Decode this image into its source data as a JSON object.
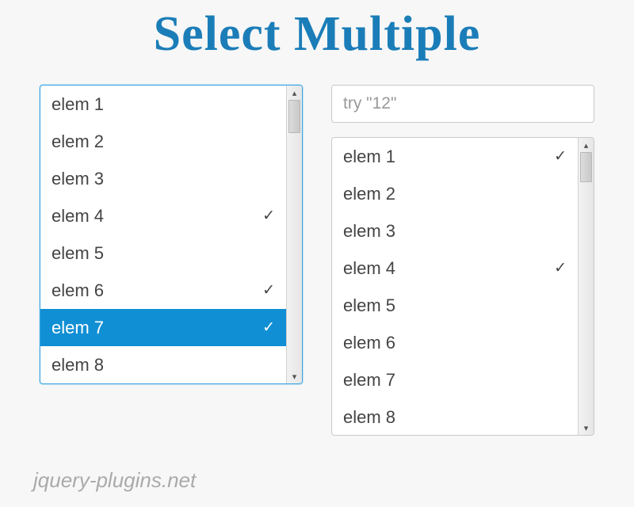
{
  "title": "Select Multiple",
  "watermark": "jquery-plugins.net",
  "search": {
    "placeholder": "try \"12\""
  },
  "left": {
    "items": [
      {
        "label": "elem 1",
        "checked": false,
        "active": false
      },
      {
        "label": "elem 2",
        "checked": false,
        "active": false
      },
      {
        "label": "elem 3",
        "checked": false,
        "active": false
      },
      {
        "label": "elem 4",
        "checked": true,
        "active": false
      },
      {
        "label": "elem 5",
        "checked": false,
        "active": false
      },
      {
        "label": "elem 6",
        "checked": true,
        "active": false
      },
      {
        "label": "elem 7",
        "checked": true,
        "active": true
      },
      {
        "label": "elem 8",
        "checked": false,
        "active": false
      }
    ]
  },
  "right": {
    "items": [
      {
        "label": "elem 1",
        "checked": true,
        "active": false
      },
      {
        "label": "elem 2",
        "checked": false,
        "active": false
      },
      {
        "label": "elem 3",
        "checked": false,
        "active": false
      },
      {
        "label": "elem 4",
        "checked": true,
        "active": false
      },
      {
        "label": "elem 5",
        "checked": false,
        "active": false
      },
      {
        "label": "elem 6",
        "checked": false,
        "active": false
      },
      {
        "label": "elem 7",
        "checked": false,
        "active": false
      },
      {
        "label": "elem 8",
        "checked": false,
        "active": false
      }
    ]
  },
  "glyphs": {
    "check": "✓",
    "up": "▴",
    "down": "▾"
  }
}
